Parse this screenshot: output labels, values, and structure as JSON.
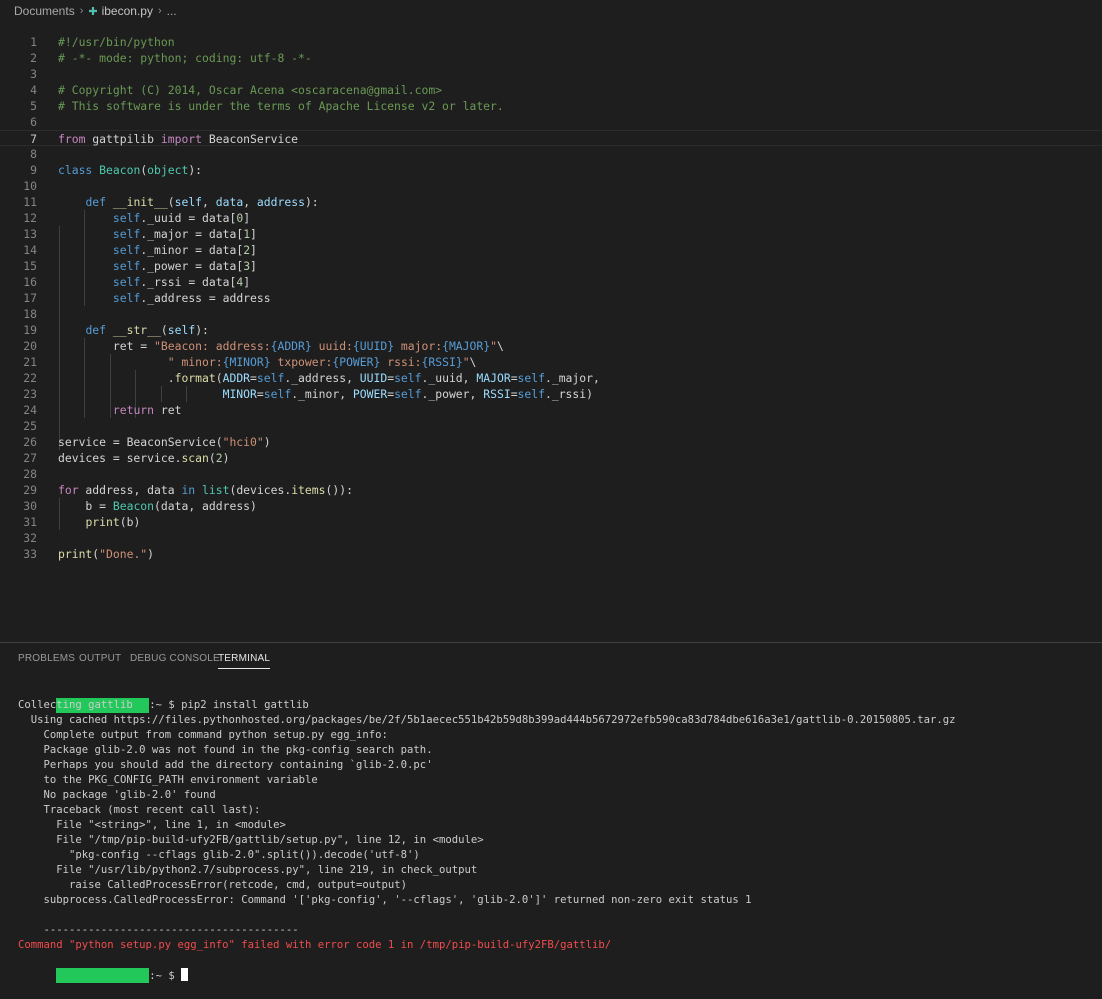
{
  "breadcrumb": {
    "folder": "Documents",
    "file": "ibecon.py",
    "more": "..."
  },
  "editor": {
    "active_line": 7,
    "lines": [
      {
        "n": "1",
        "parts": [
          {
            "t": "#!/usr/bin/python",
            "c": "cm"
          }
        ]
      },
      {
        "n": "2",
        "parts": [
          {
            "t": "# -*- mode: python; coding: utf-8 -*-",
            "c": "cm"
          }
        ]
      },
      {
        "n": "3",
        "parts": []
      },
      {
        "n": "4",
        "parts": [
          {
            "t": "# Copyright (C) 2014, Oscar Acena <oscaracena@gmail.com>",
            "c": "cm"
          }
        ]
      },
      {
        "n": "5",
        "parts": [
          {
            "t": "# This software is under the terms of Apache License v2 or later.",
            "c": "cm"
          }
        ]
      },
      {
        "n": "6",
        "parts": []
      },
      {
        "n": "7",
        "parts": [
          {
            "t": "from",
            "c": "kw2"
          },
          {
            "t": " gattpilib ",
            "c": ""
          },
          {
            "t": "import",
            "c": "kw2"
          },
          {
            "t": " BeaconService",
            "c": ""
          }
        ]
      },
      {
        "n": "8",
        "parts": []
      },
      {
        "n": "9",
        "parts": [
          {
            "t": "class",
            "c": "kw"
          },
          {
            "t": " ",
            "c": ""
          },
          {
            "t": "Beacon",
            "c": "cls"
          },
          {
            "t": "(",
            "c": ""
          },
          {
            "t": "object",
            "c": "cls"
          },
          {
            "t": "):",
            "c": ""
          }
        ]
      },
      {
        "n": "10",
        "parts": []
      },
      {
        "n": "11",
        "parts": [
          {
            "t": "    ",
            "c": ""
          },
          {
            "t": "def",
            "c": "kw"
          },
          {
            "t": " ",
            "c": ""
          },
          {
            "t": "__init__",
            "c": "fn"
          },
          {
            "t": "(",
            "c": ""
          },
          {
            "t": "self",
            "c": "var"
          },
          {
            "t": ", ",
            "c": ""
          },
          {
            "t": "data",
            "c": "var"
          },
          {
            "t": ", ",
            "c": ""
          },
          {
            "t": "address",
            "c": "var"
          },
          {
            "t": "):",
            "c": ""
          }
        ]
      },
      {
        "n": "12",
        "parts": [
          {
            "t": "        ",
            "c": ""
          },
          {
            "t": "self",
            "c": "kw"
          },
          {
            "t": "._uuid = data[",
            "c": ""
          },
          {
            "t": "0",
            "c": "num2"
          },
          {
            "t": "]",
            "c": ""
          }
        ]
      },
      {
        "n": "13",
        "parts": [
          {
            "t": "        ",
            "c": ""
          },
          {
            "t": "self",
            "c": "kw"
          },
          {
            "t": "._major = data[",
            "c": ""
          },
          {
            "t": "1",
            "c": "num2"
          },
          {
            "t": "]",
            "c": ""
          }
        ]
      },
      {
        "n": "14",
        "parts": [
          {
            "t": "        ",
            "c": ""
          },
          {
            "t": "self",
            "c": "kw"
          },
          {
            "t": "._minor = data[",
            "c": ""
          },
          {
            "t": "2",
            "c": "num2"
          },
          {
            "t": "]",
            "c": ""
          }
        ]
      },
      {
        "n": "15",
        "parts": [
          {
            "t": "        ",
            "c": ""
          },
          {
            "t": "self",
            "c": "kw"
          },
          {
            "t": "._power = data[",
            "c": ""
          },
          {
            "t": "3",
            "c": "num2"
          },
          {
            "t": "]",
            "c": ""
          }
        ]
      },
      {
        "n": "16",
        "parts": [
          {
            "t": "        ",
            "c": ""
          },
          {
            "t": "self",
            "c": "kw"
          },
          {
            "t": "._rssi = data[",
            "c": ""
          },
          {
            "t": "4",
            "c": "num2"
          },
          {
            "t": "]",
            "c": ""
          }
        ]
      },
      {
        "n": "17",
        "parts": [
          {
            "t": "        ",
            "c": ""
          },
          {
            "t": "self",
            "c": "kw"
          },
          {
            "t": "._address = address",
            "c": ""
          }
        ]
      },
      {
        "n": "18",
        "parts": []
      },
      {
        "n": "19",
        "parts": [
          {
            "t": "    ",
            "c": ""
          },
          {
            "t": "def",
            "c": "kw"
          },
          {
            "t": " ",
            "c": ""
          },
          {
            "t": "__str__",
            "c": "fn"
          },
          {
            "t": "(",
            "c": ""
          },
          {
            "t": "self",
            "c": "var"
          },
          {
            "t": "):",
            "c": ""
          }
        ]
      },
      {
        "n": "20",
        "parts": [
          {
            "t": "        ret = ",
            "c": ""
          },
          {
            "t": "\"Beacon: address:",
            "c": "str"
          },
          {
            "t": "{ADDR}",
            "c": "ph"
          },
          {
            "t": " uuid:",
            "c": "str"
          },
          {
            "t": "{UUID}",
            "c": "ph"
          },
          {
            "t": " major:",
            "c": "str"
          },
          {
            "t": "{MAJOR}",
            "c": "ph"
          },
          {
            "t": "\"",
            "c": "str"
          },
          {
            "t": "\\",
            "c": ""
          }
        ]
      },
      {
        "n": "21",
        "parts": [
          {
            "t": "                ",
            "c": ""
          },
          {
            "t": "\" minor:",
            "c": "str"
          },
          {
            "t": "{MINOR}",
            "c": "ph"
          },
          {
            "t": " txpower:",
            "c": "str"
          },
          {
            "t": "{POWER}",
            "c": "ph"
          },
          {
            "t": " rssi:",
            "c": "str"
          },
          {
            "t": "{RSSI}",
            "c": "ph"
          },
          {
            "t": "\"",
            "c": "str"
          },
          {
            "t": "\\",
            "c": ""
          }
        ]
      },
      {
        "n": "22",
        "parts": [
          {
            "t": "                .",
            "c": ""
          },
          {
            "t": "format",
            "c": "fn"
          },
          {
            "t": "(",
            "c": ""
          },
          {
            "t": "ADDR",
            "c": "var"
          },
          {
            "t": "=",
            "c": ""
          },
          {
            "t": "self",
            "c": "kw"
          },
          {
            "t": "._address, ",
            "c": ""
          },
          {
            "t": "UUID",
            "c": "var"
          },
          {
            "t": "=",
            "c": ""
          },
          {
            "t": "self",
            "c": "kw"
          },
          {
            "t": "._uuid, ",
            "c": ""
          },
          {
            "t": "MAJOR",
            "c": "var"
          },
          {
            "t": "=",
            "c": ""
          },
          {
            "t": "self",
            "c": "kw"
          },
          {
            "t": "._major,",
            "c": ""
          }
        ]
      },
      {
        "n": "23",
        "parts": [
          {
            "t": "                        ",
            "c": ""
          },
          {
            "t": "MINOR",
            "c": "var"
          },
          {
            "t": "=",
            "c": ""
          },
          {
            "t": "self",
            "c": "kw"
          },
          {
            "t": "._minor, ",
            "c": ""
          },
          {
            "t": "POWER",
            "c": "var"
          },
          {
            "t": "=",
            "c": ""
          },
          {
            "t": "self",
            "c": "kw"
          },
          {
            "t": "._power, ",
            "c": ""
          },
          {
            "t": "RSSI",
            "c": "var"
          },
          {
            "t": "=",
            "c": ""
          },
          {
            "t": "self",
            "c": "kw"
          },
          {
            "t": "._rssi)",
            "c": ""
          }
        ]
      },
      {
        "n": "24",
        "parts": [
          {
            "t": "        ",
            "c": ""
          },
          {
            "t": "return",
            "c": "kw2"
          },
          {
            "t": " ret",
            "c": ""
          }
        ]
      },
      {
        "n": "25",
        "parts": []
      },
      {
        "n": "26",
        "parts": [
          {
            "t": "service = BeaconService(",
            "c": ""
          },
          {
            "t": "\"hci0\"",
            "c": "str"
          },
          {
            "t": ")",
            "c": ""
          }
        ]
      },
      {
        "n": "27",
        "parts": [
          {
            "t": "devices = service.",
            "c": ""
          },
          {
            "t": "scan",
            "c": "fn"
          },
          {
            "t": "(",
            "c": ""
          },
          {
            "t": "2",
            "c": "num2"
          },
          {
            "t": ")",
            "c": ""
          }
        ]
      },
      {
        "n": "28",
        "parts": []
      },
      {
        "n": "29",
        "parts": [
          {
            "t": "for",
            "c": "kw2"
          },
          {
            "t": " address, data ",
            "c": ""
          },
          {
            "t": "in",
            "c": "kw"
          },
          {
            "t": " ",
            "c": ""
          },
          {
            "t": "list",
            "c": "cls"
          },
          {
            "t": "(devices.",
            "c": ""
          },
          {
            "t": "items",
            "c": "fn"
          },
          {
            "t": "()):",
            "c": ""
          }
        ]
      },
      {
        "n": "30",
        "parts": [
          {
            "t": "    b = ",
            "c": ""
          },
          {
            "t": "Beacon",
            "c": "cls"
          },
          {
            "t": "(data, address)",
            "c": ""
          }
        ]
      },
      {
        "n": "31",
        "parts": [
          {
            "t": "    ",
            "c": ""
          },
          {
            "t": "print",
            "c": "fn"
          },
          {
            "t": "(b)",
            "c": ""
          }
        ]
      },
      {
        "n": "32",
        "parts": []
      },
      {
        "n": "33",
        "parts": [
          {
            "t": "print",
            "c": "fn"
          },
          {
            "t": "(",
            "c": ""
          },
          {
            "t": "\"Done.\"",
            "c": "str"
          },
          {
            "t": ")",
            "c": ""
          }
        ]
      }
    ]
  },
  "panel": {
    "tabs": [
      "PROBLEMS",
      "OUTPUT",
      "DEBUG CONSOLE",
      "TERMINAL"
    ],
    "active_tab": "TERMINAL"
  },
  "terminal": {
    "prompt_suffix": ":~ $ ",
    "command": "pip2 install gattlib",
    "output": [
      "Collecting gattlib",
      "  Using cached https://files.pythonhosted.org/packages/be/2f/5b1aecec551b42b59d8b399ad444b5672972efb590ca83d784dbe616a3e1/gattlib-0.20150805.tar.gz",
      "    Complete output from command python setup.py egg_info:",
      "    Package glib-2.0 was not found in the pkg-config search path.",
      "    Perhaps you should add the directory containing `glib-2.0.pc'",
      "    to the PKG_CONFIG_PATH environment variable",
      "    No package 'glib-2.0' found",
      "    Traceback (most recent call last):",
      "      File \"<string>\", line 1, in <module>",
      "      File \"/tmp/pip-build-ufy2FB/gattlib/setup.py\", line 12, in <module>",
      "        \"pkg-config --cflags glib-2.0\".split()).decode('utf-8')",
      "      File \"/usr/lib/python2.7/subprocess.py\", line 219, in check_output",
      "        raise CalledProcessError(retcode, cmd, output=output)",
      "    subprocess.CalledProcessError: Command '['pkg-config', '--cflags', 'glib-2.0']' returned non-zero exit status 1",
      "",
      "    ----------------------------------------"
    ],
    "error_line": "Command \"python setup.py egg_info\" failed with error code 1 in /tmp/pip-build-ufy2FB/gattlib/",
    "prompt_color": "#23c85a"
  }
}
